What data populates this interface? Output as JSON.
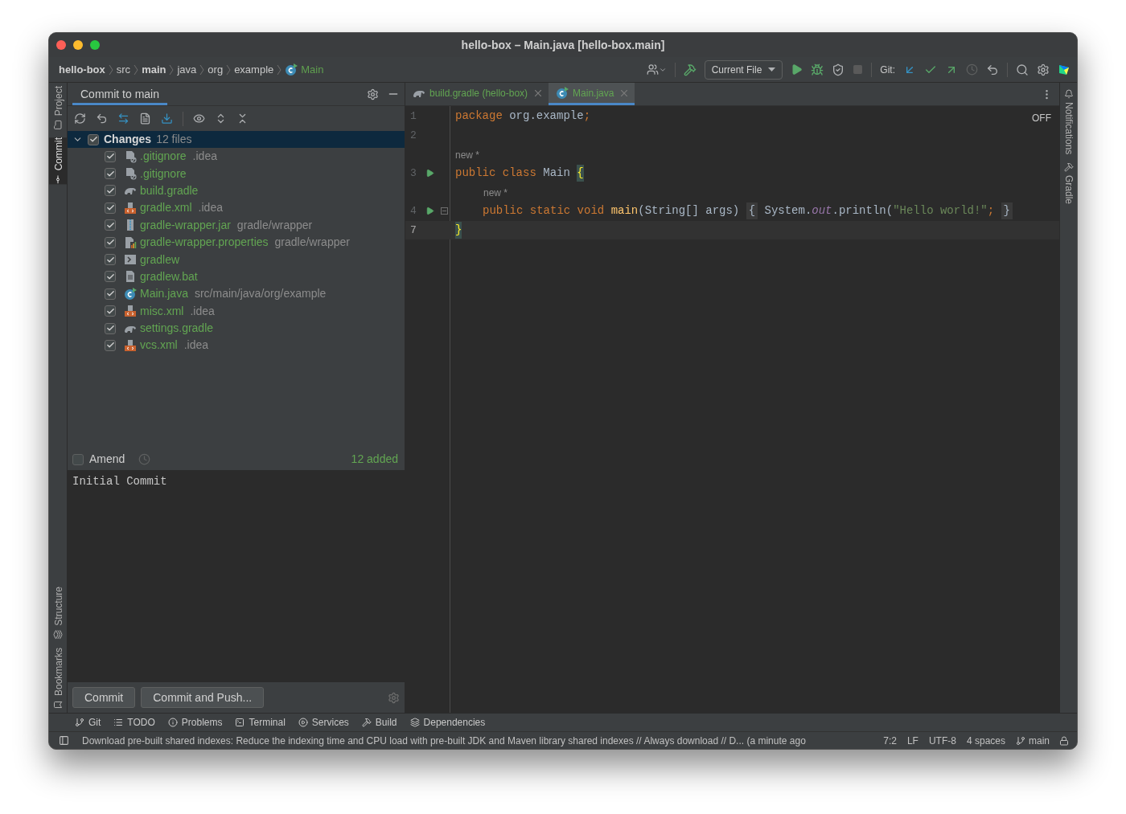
{
  "window": {
    "title": "hello-box – Main.java [hello-box.main]"
  },
  "breadcrumbs": [
    {
      "label": "hello-box",
      "kind": "bold"
    },
    {
      "label": "src",
      "kind": "plain"
    },
    {
      "label": "main",
      "kind": "bold"
    },
    {
      "label": "java",
      "kind": "plain"
    },
    {
      "label": "org",
      "kind": "plain"
    },
    {
      "label": "example",
      "kind": "plain"
    },
    {
      "label": "Main",
      "kind": "class"
    }
  ],
  "toolbar": {
    "run_config": "Current File",
    "git_label": "Git:"
  },
  "left_strip": {
    "top": [
      {
        "label": "Project",
        "selected": false
      },
      {
        "label": "Commit",
        "selected": true
      }
    ],
    "bottom": [
      {
        "label": "Structure",
        "selected": false
      },
      {
        "label": "Bookmarks",
        "selected": false
      }
    ]
  },
  "commit_panel": {
    "title": "Commit to main",
    "changes": {
      "label": "Changes",
      "count": "12 files",
      "checked": true,
      "expanded": true,
      "selected": true
    },
    "files": [
      {
        "name": ".gitignore",
        "path": ".idea",
        "checked": true,
        "kind": "ignore"
      },
      {
        "name": ".gitignore",
        "checked": true,
        "kind": "ignore"
      },
      {
        "name": "build.gradle",
        "checked": true,
        "kind": "gradle"
      },
      {
        "name": "gradle.xml",
        "path": ".idea",
        "checked": true,
        "kind": "xml"
      },
      {
        "name": "gradle-wrapper.jar",
        "path": "gradle/wrapper",
        "checked": true,
        "kind": "jar"
      },
      {
        "name": "gradle-wrapper.properties",
        "path": "gradle/wrapper",
        "checked": true,
        "kind": "properties"
      },
      {
        "name": "gradlew",
        "checked": true,
        "kind": "shell"
      },
      {
        "name": "gradlew.bat",
        "checked": true,
        "kind": "text"
      },
      {
        "name": "Main.java",
        "path": "src/main/java/org/example",
        "checked": true,
        "kind": "class"
      },
      {
        "name": "misc.xml",
        "path": ".idea",
        "checked": true,
        "kind": "xml"
      },
      {
        "name": "settings.gradle",
        "checked": true,
        "kind": "gradle"
      },
      {
        "name": "vcs.xml",
        "path": ".idea",
        "checked": true,
        "kind": "xml"
      }
    ],
    "amend": {
      "label": "Amend",
      "checked": false
    },
    "summary": "12 added",
    "message": "Initial Commit",
    "buttons": [
      "Commit",
      "Commit and Push..."
    ]
  },
  "editor": {
    "tabs": [
      {
        "label": "build.gradle (hello-box)",
        "selected": false,
        "kind": "gradle"
      },
      {
        "label": "Main.java",
        "selected": true,
        "kind": "class"
      }
    ],
    "inspection": "OFF",
    "lines": [
      {
        "kind": "code",
        "number": "1",
        "current": false,
        "tokens": [
          {
            "kind": "kw",
            "s": "package"
          },
          {
            "kind": "plain",
            "s": " org.example"
          },
          {
            "kind": "kw",
            "s": ";"
          }
        ]
      },
      {
        "kind": "code",
        "number": "2",
        "current": false
      },
      {
        "kind": "hint",
        "text": "new *"
      },
      {
        "kind": "code",
        "number": "3",
        "run": true,
        "current": false,
        "tokens": [
          {
            "kind": "kw",
            "s": "public class"
          },
          {
            "kind": "plain",
            "s": " Main "
          },
          {
            "kind": "match",
            "s": "{"
          }
        ]
      },
      {
        "kind": "hint",
        "text": "new *",
        "indent": true
      },
      {
        "kind": "code",
        "number": "4",
        "run": true,
        "current": false,
        "fold": true,
        "indent": true,
        "tokens": [
          {
            "kind": "kw",
            "s": "public static void"
          },
          {
            "kind": "fn",
            "s": " main"
          },
          {
            "kind": "plain",
            "s": "(String[] args) "
          },
          {
            "kind": "folded",
            "s": "{"
          },
          {
            "kind": "plain",
            "s": " System."
          },
          {
            "kind": "field",
            "s": "out"
          },
          {
            "kind": "plain",
            "s": ".println("
          },
          {
            "kind": "str",
            "s": "\"Hello world!\""
          },
          {
            "kind": "kw",
            "s": "; "
          },
          {
            "kind": "folded",
            "s": "}"
          }
        ]
      },
      {
        "kind": "code",
        "number": "7",
        "current": true,
        "tokens": [
          {
            "kind": "match",
            "s": "}"
          }
        ]
      }
    ]
  },
  "right_strip": [
    {
      "label": "Notifications"
    },
    {
      "label": "Gradle"
    }
  ],
  "bottom_tabs": [
    "Git",
    "TODO",
    "Problems",
    "Terminal",
    "Services",
    "Build",
    "Dependencies"
  ],
  "status": {
    "message": "Download pre-built shared indexes: Reduce the indexing time and CPU load with pre-built JDK and Maven library shared indexes // Always download // D... (a minute ago",
    "items": [
      "7:2",
      "LF",
      "UTF-8",
      "4 spaces"
    ],
    "branch": "main"
  }
}
